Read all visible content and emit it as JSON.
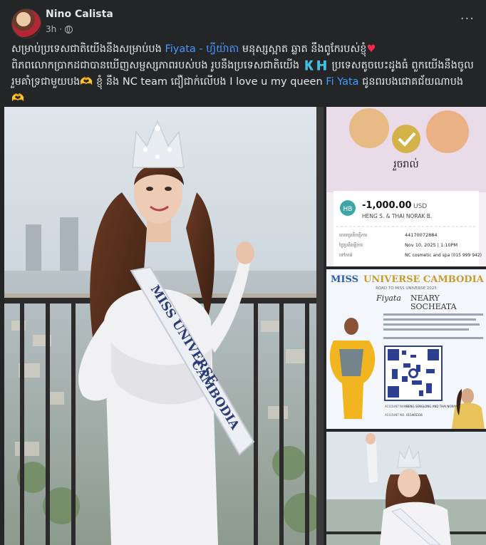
{
  "post": {
    "author": "Nino Calista",
    "time": "3h",
    "more_label": "···",
    "text_1": "សម្រាប់ប្រទេសជាតិយើងនឹងសម្រាប់បង ",
    "mention_1": "Fiyata - ហ្វីយ៉ាតា",
    "text_2": " មនុស្សស្អាត ឆ្លាត នឹងពូកែរបស់ខ្ញុំ",
    "text_3": "ពិភពលោកប្រាកដជាបានឃើញសម្ផស្សភាពរបស់បង រូបនឹងប្រទេសជាតិយើង 🇰🇭 ប្រទេសតូចបេះដូងធំ ពួកយើងនឹងចូលរួមគាំទ្រជាមួយបង🫶 ខ្ញុំ នឹង NC team ជឿជាក់លើបង I love u my queen ",
    "mention_2": "Fi Yata",
    "text_4": " ជូនពរបងជោគជ័យណាបង🫶"
  },
  "receipt": {
    "status": "រួចរាល់",
    "initials": "HB",
    "amount": "-1,000.00",
    "currency": "USD",
    "name": "HENG S. & THAI NORAK B.",
    "row1_label": "លេខប្រតិបត្តិការ",
    "row1_value": "44170072884",
    "row2_label": "ថ្ងៃប្រតិបត្តិការ",
    "row2_value": "Nov 10, 2025 | 1:10PM",
    "row3_label": "ទៅកាន់",
    "row3_value": "NC cosmetic and spa (015 999 942)"
  },
  "poster": {
    "title_left": "MISS",
    "title_right": "UNIVERSE CAMBODIA",
    "subtitle": "ROAD TO MISS UNIVERSE 2025",
    "script_name": "Fiyata",
    "name_line1": "NEARY",
    "name_line2": "SOCHEATA",
    "account_name_label": "ACCOUNT NAME",
    "account_name": "HENG SENGLONG AND THAI NORAK BANDITH",
    "account_number_label": "ACCOUNT NO.",
    "account_number": "015465316"
  },
  "sash": {
    "line1": "MISS UNIVERSE",
    "line2": "CAMBODIA"
  },
  "colors": {
    "background": "#242526",
    "text": "#e4e6eb",
    "secondary": "#b0b3b8",
    "link": "#4599ff",
    "aba_blue": "#3b4ea3",
    "gold": "#c99a2e"
  }
}
